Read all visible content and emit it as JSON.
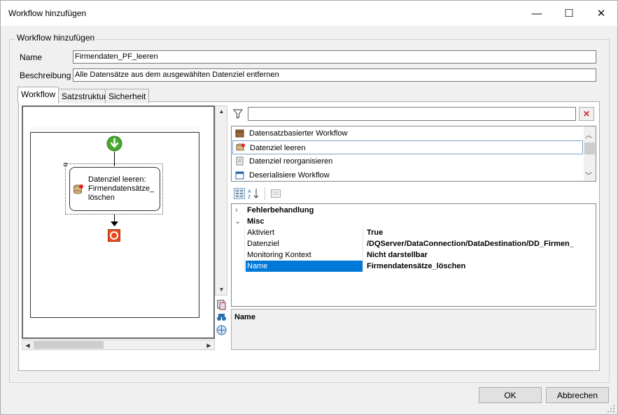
{
  "window": {
    "title": "Workflow hinzufügen",
    "minimize": "—",
    "maximize": "☐",
    "close": "✕"
  },
  "group": {
    "legend": "Workflow hinzufügen"
  },
  "form": {
    "name_label": "Name",
    "name_value": "Firmendaten_PF_leeren",
    "desc_label": "Beschreibung",
    "desc_value": "Alle Datensätze aus dem ausgewählten Datenziel entfernen"
  },
  "tabs": [
    {
      "label": "Workflow",
      "active": true
    },
    {
      "label": "Satzstruktur",
      "active": false
    },
    {
      "label": "Sicherheit",
      "active": false
    }
  ],
  "designer": {
    "activity_text": "Datenziel leeren: Firmendatensätze_ löschen"
  },
  "toolbox": {
    "filter_value": "",
    "items": [
      {
        "label": "Datensatzbasierter Workflow",
        "icon": "workflow-box-icon",
        "selected": false
      },
      {
        "label": "Datenziel leeren",
        "icon": "database-clear-icon",
        "selected": true
      },
      {
        "label": "Datenziel reorganisieren",
        "icon": "document-reorganize-icon",
        "selected": false
      },
      {
        "label": "Deserialisiere Workflow",
        "icon": "window-icon",
        "selected": false
      }
    ]
  },
  "properties": {
    "rows": [
      {
        "type": "category",
        "name": "Fehlerbehandlung",
        "expanded": false
      },
      {
        "type": "category",
        "name": "Misc",
        "expanded": true
      },
      {
        "type": "prop",
        "name": "Aktiviert",
        "value": "True"
      },
      {
        "type": "prop",
        "name": "Datenziel",
        "value": "/DQServer/DataConnection/DataDestination/DD_Firmen_"
      },
      {
        "type": "prop",
        "name": "Monitoring Kontext",
        "value": "Nicht darstellbar"
      },
      {
        "type": "prop",
        "name": "Name",
        "value": "Firmendatensätze_löschen",
        "selected": true
      }
    ],
    "description_title": "Name"
  },
  "buttons": {
    "ok": "OK",
    "cancel": "Abbrechen"
  },
  "colors": {
    "selection": "#0078d7",
    "stop": "#e8491d",
    "start": "#47a82e"
  }
}
